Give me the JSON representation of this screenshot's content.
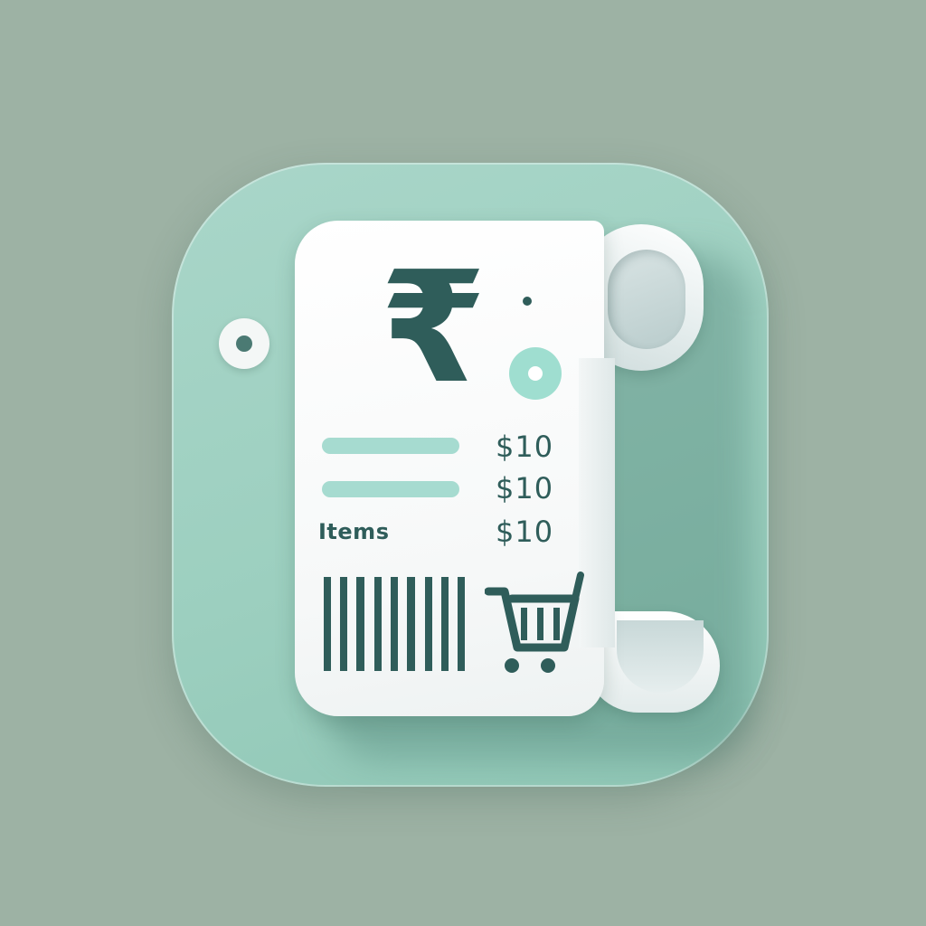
{
  "receipt": {
    "currency_symbol": "₹",
    "lines": [
      {
        "price": "$10"
      },
      {
        "price": "$10"
      },
      {
        "label": "Items",
        "price": "$10"
      }
    ]
  },
  "icons": {
    "main": "receipt-icon",
    "currency": "rupee-icon",
    "barcode": "barcode-icon",
    "cart": "shopping-cart-icon"
  },
  "colors": {
    "background": "#9db2a4",
    "tile": "#a9d6c9",
    "accent": "#a6dbd0",
    "ink": "#2f5d5a",
    "paper": "#ffffff"
  }
}
